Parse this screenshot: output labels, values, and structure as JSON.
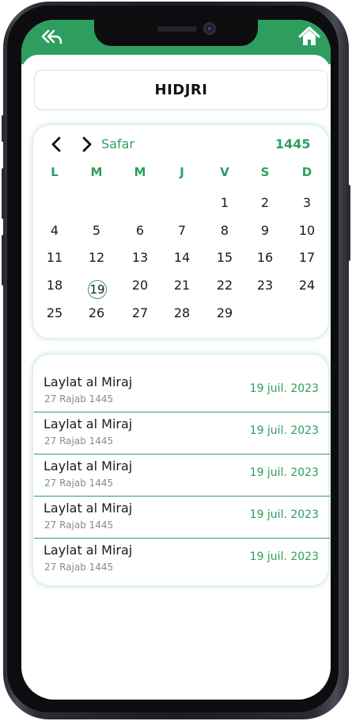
{
  "header": {
    "back_icon": "double-back-arrow-icon",
    "home_icon": "home-icon",
    "accent_color": "#2e9e5e"
  },
  "title": "HIDJRI",
  "calendar": {
    "month": "Safar",
    "year": "1445",
    "weekdays": [
      "L",
      "M",
      "M",
      "J",
      "V",
      "S",
      "D"
    ],
    "days": [
      [
        "",
        "",
        "",
        "",
        "1",
        "2",
        "3"
      ],
      [
        "4",
        "5",
        "6",
        "7",
        "8",
        "9",
        "10"
      ],
      [
        "11",
        "12",
        "13",
        "14",
        "15",
        "16",
        "17"
      ],
      [
        "18",
        "19",
        "20",
        "21",
        "22",
        "23",
        "24"
      ],
      [
        "25",
        "26",
        "27",
        "28",
        "29",
        "",
        ""
      ]
    ],
    "selected_day": "19"
  },
  "events": [
    {
      "name": "Laylat al Miraj",
      "hijri": "27 Rajab 1445",
      "date": "19 juil. 2023"
    },
    {
      "name": "Laylat al Miraj",
      "hijri": "27 Rajab 1445",
      "date": "19 juil. 2023"
    },
    {
      "name": "Laylat al Miraj",
      "hijri": "27 Rajab 1445",
      "date": "19 juil. 2023"
    },
    {
      "name": "Laylat al Miraj",
      "hijri": "27 Rajab 1445",
      "date": "19 juil. 2023"
    },
    {
      "name": "Laylat al Miraj",
      "hijri": "27 Rajab 1445",
      "date": "19 juil. 2023"
    }
  ]
}
